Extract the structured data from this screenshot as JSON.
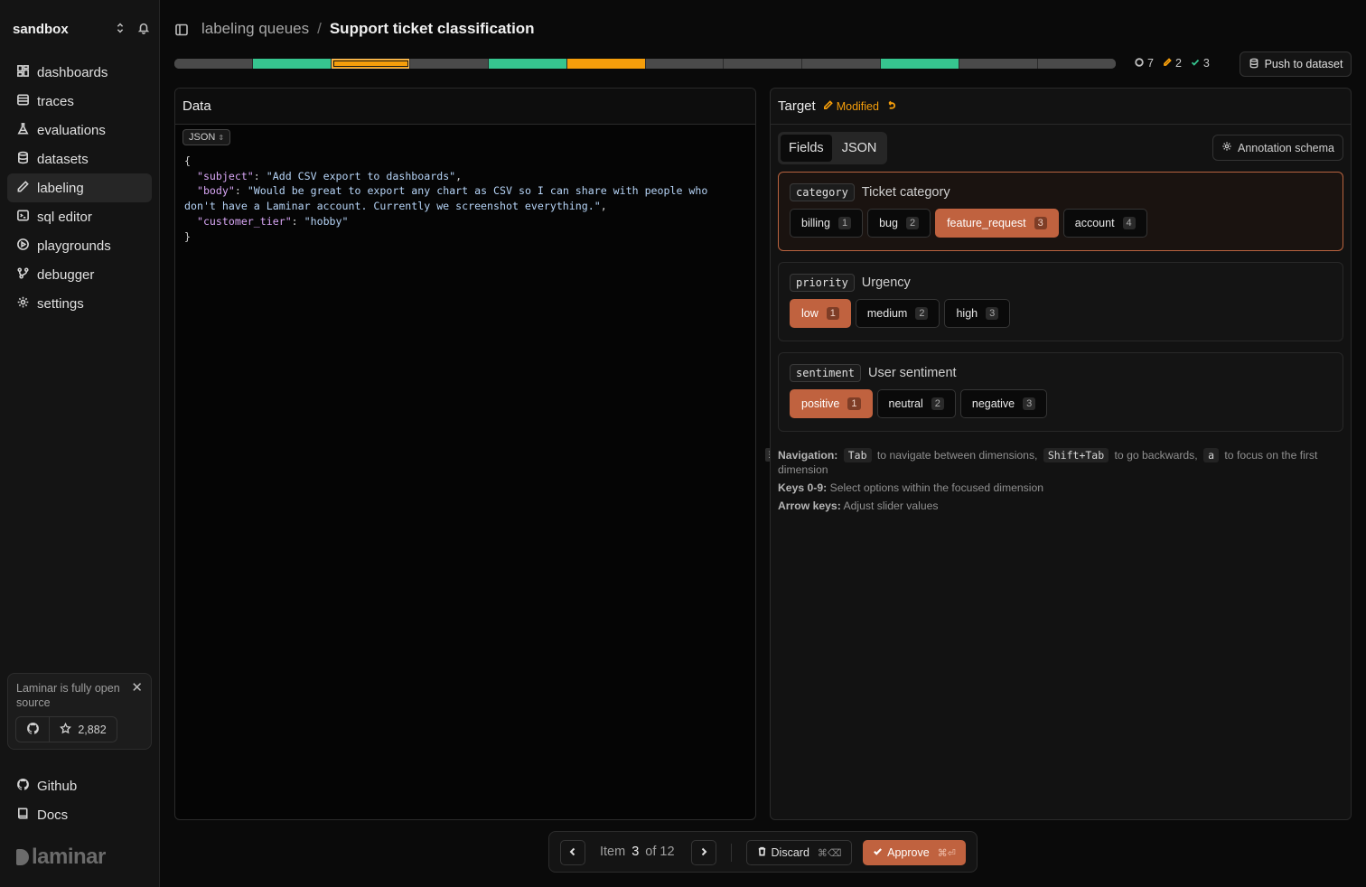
{
  "sidebar": {
    "org": "sandbox",
    "items": [
      {
        "label": "dashboards",
        "icon": "dashboard-icon"
      },
      {
        "label": "traces",
        "icon": "list-icon"
      },
      {
        "label": "evaluations",
        "icon": "flask-icon"
      },
      {
        "label": "datasets",
        "icon": "database-icon"
      },
      {
        "label": "labeling",
        "icon": "pen-icon",
        "active": true
      },
      {
        "label": "sql editor",
        "icon": "terminal-icon"
      },
      {
        "label": "playgrounds",
        "icon": "play-icon"
      },
      {
        "label": "debugger",
        "icon": "git-branch-icon"
      },
      {
        "label": "settings",
        "icon": "gear-icon"
      }
    ],
    "promo": {
      "text": "Laminar is fully open source",
      "stars": "2,882"
    },
    "bottom": [
      {
        "label": "Github",
        "icon": "github-icon"
      },
      {
        "label": "Docs",
        "icon": "book-icon"
      }
    ],
    "brand": "laminar"
  },
  "header": {
    "breadcrumb_parent": "labeling queues",
    "breadcrumb_sep": "/",
    "breadcrumb_current": "Support ticket classification"
  },
  "progress": {
    "segments": [
      "pending",
      "approved",
      "modified-current",
      "pending",
      "approved",
      "modified",
      "pending",
      "pending",
      "pending",
      "approved",
      "pending",
      "pending"
    ],
    "stats": {
      "pending": "7",
      "modified": "2",
      "approved": "3"
    },
    "push_label": "Push to dataset"
  },
  "colors": {
    "approved": "#36c58f",
    "modified": "#f59e0b",
    "pending": "#4a4a4a",
    "accent": "#c0623f"
  },
  "data_panel": {
    "title": "Data",
    "format": "JSON",
    "json": {
      "open": "{",
      "subject_key": "\"subject\"",
      "subject_val": "\"Add CSV export to dashboards\"",
      "body_key": "\"body\"",
      "body_val": "\"Would be great to export any chart as CSV so I can share with people who don't have a Laminar account. Currently we screenshot everything.\"",
      "tier_key": "\"customer_tier\"",
      "tier_val": "\"hobby\"",
      "close": "}"
    }
  },
  "target_panel": {
    "title": "Target",
    "status": "Modified",
    "tabs": [
      "Fields",
      "JSON"
    ],
    "schema_label": "Annotation schema",
    "dimensions": [
      {
        "key": "category",
        "label": "Ticket category",
        "options": [
          {
            "label": "billing",
            "kb": "1"
          },
          {
            "label": "bug",
            "kb": "2"
          },
          {
            "label": "feature_request",
            "kb": "3",
            "selected": true
          },
          {
            "label": "account",
            "kb": "4"
          }
        ]
      },
      {
        "key": "priority",
        "label": "Urgency",
        "options": [
          {
            "label": "low",
            "kb": "1",
            "selected": true
          },
          {
            "label": "medium",
            "kb": "2"
          },
          {
            "label": "high",
            "kb": "3"
          }
        ]
      },
      {
        "key": "sentiment",
        "label": "User sentiment",
        "options": [
          {
            "label": "positive",
            "kb": "1",
            "selected": true
          },
          {
            "label": "neutral",
            "kb": "2"
          },
          {
            "label": "negative",
            "kb": "3"
          }
        ]
      }
    ],
    "help": {
      "nav_label": "Navigation:",
      "tab_key": "Tab",
      "tab_text": "to navigate between dimensions,",
      "shift_key": "Shift+Tab",
      "shift_text": "to go backwards,",
      "a_key": "a",
      "a_text": "to focus on the first dimension",
      "keys_label": "Keys 0-9:",
      "keys_text": "Select options within the focused dimension",
      "arrows_label": "Arrow keys:",
      "arrows_text": "Adjust slider values"
    }
  },
  "footer": {
    "item_label": "Item",
    "current": "3",
    "of_label": "of 12",
    "discard_label": "Discard",
    "discard_shortcut": "⌘⌫",
    "approve_label": "Approve",
    "approve_shortcut": "⌘⏎"
  }
}
